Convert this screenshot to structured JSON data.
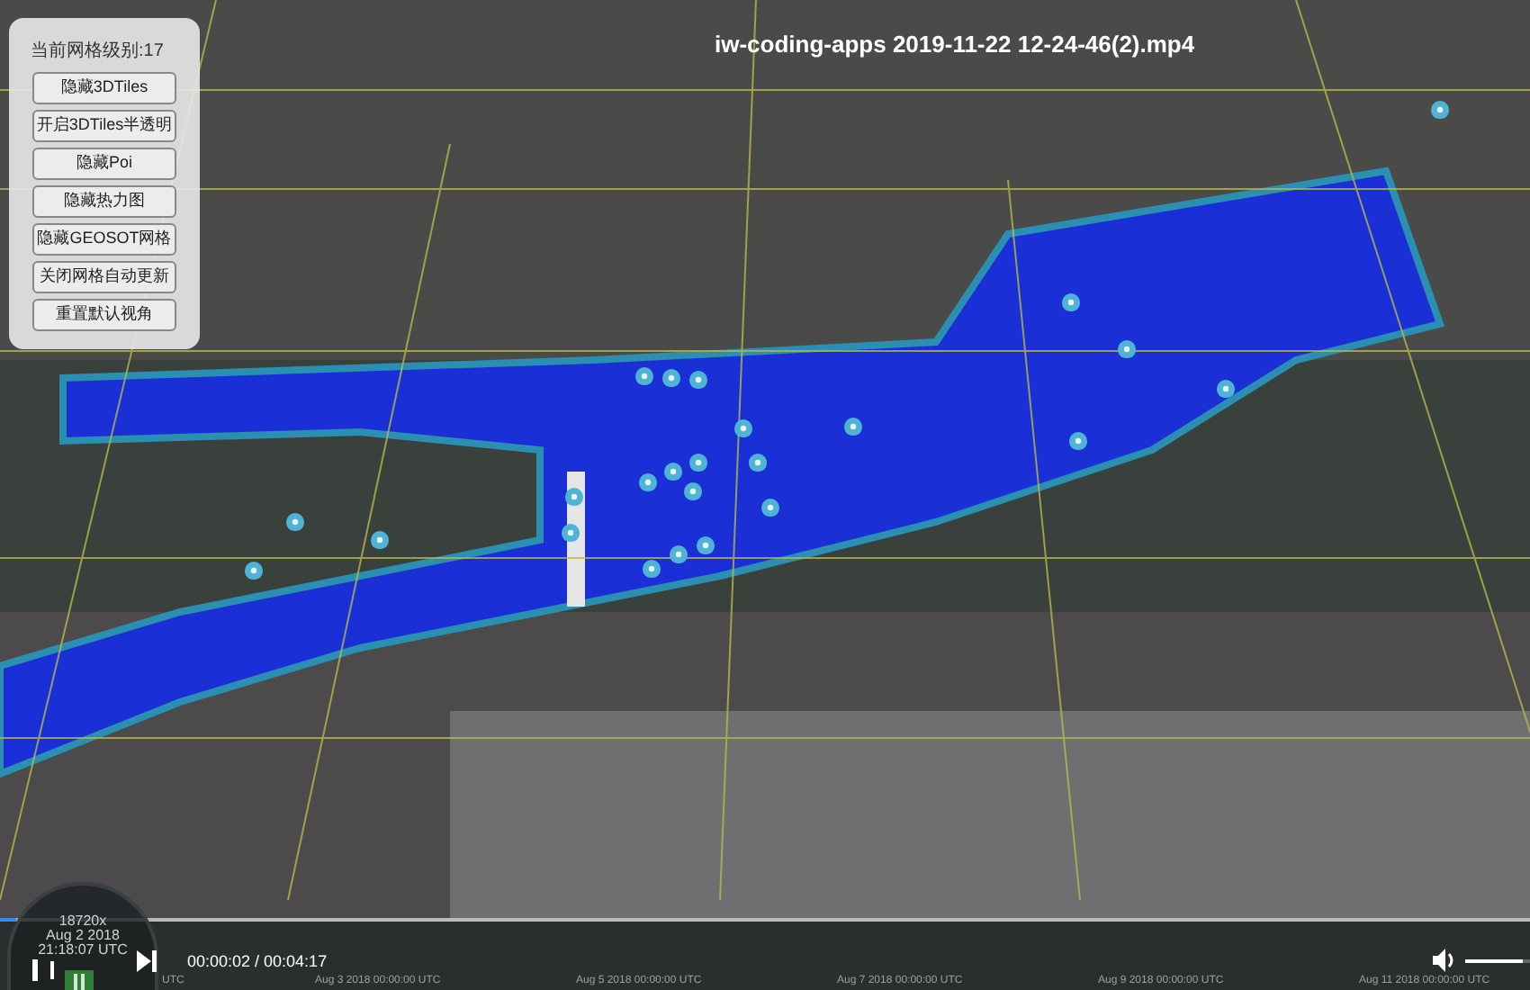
{
  "video": {
    "title": "iw-coding-apps 2019-11-22 12-24-46(2).mp4",
    "time": "00:00:02 / 00:04:17",
    "progress": {
      "level": 0.01
    },
    "volume": {
      "level": 0.9
    }
  },
  "panel": {
    "heading": "当前网格级别:17",
    "buttons": [
      "隐藏3DTiles",
      "开启3DTiles半透明",
      "隐藏Poi",
      "隐藏热力图",
      "隐藏GEOSOT网格",
      "关闭网格自动更新",
      "重置默认视角"
    ]
  },
  "clock": {
    "speed": "18720x",
    "date": "Aug 2 2018",
    "time": "21:18:07 UTC"
  },
  "timeline": {
    "labels": [
      "UTC",
      "Aug 3 2018 00:00:00 UTC",
      "Aug 5 2018 00:00:00 UTC",
      "Aug 7 2018 00:00:00 UTC",
      "Aug 9 2018 00:00:00 UTC",
      "Aug 11 2018 00:00:00 UTC"
    ]
  }
}
